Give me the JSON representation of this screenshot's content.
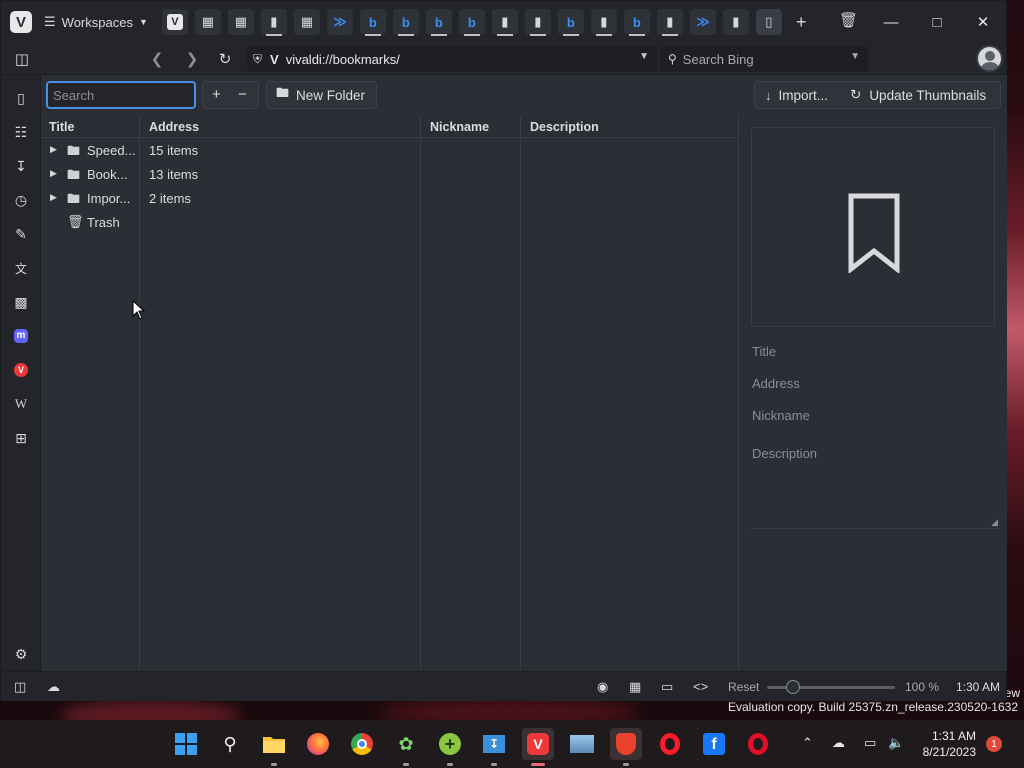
{
  "browser": {
    "workspaces_label": "Workspaces",
    "tab_icons": [
      "vivaldi",
      "grid",
      "grid",
      "doc",
      "grid",
      "bing",
      "bing",
      "bing",
      "bing",
      "bing",
      "doc",
      "doc",
      "bing",
      "doc",
      "bing",
      "doc",
      "bing",
      "doc",
      "bookmarks"
    ],
    "new_tab_label": "+",
    "url": "vivaldi://bookmarks/",
    "search_placeholder": "Search Bing"
  },
  "bookmarks": {
    "search_placeholder": "Search",
    "add_label": "+",
    "remove_label": "−",
    "new_folder_label": "New Folder",
    "import_label": "Import...",
    "update_thumbnails_label": "Update Thumbnails",
    "columns": {
      "title": "Title",
      "address": "Address",
      "nickname": "Nickname",
      "description": "Description"
    },
    "rows": [
      {
        "title": "Speed...",
        "address": "15 items",
        "expandable": true,
        "icon": "speed-dial-folder"
      },
      {
        "title": "Book...",
        "address": "13 items",
        "expandable": true,
        "icon": "folder"
      },
      {
        "title": "Impor...",
        "address": "2 items",
        "expandable": true,
        "icon": "folder"
      },
      {
        "title": "Trash",
        "address": "",
        "expandable": false,
        "icon": "trash"
      }
    ],
    "details": {
      "title_placeholder": "Title",
      "address_placeholder": "Address",
      "nickname_placeholder": "Nickname",
      "description_placeholder": "Description"
    }
  },
  "statusbar": {
    "reset_label": "Reset",
    "zoom": "100 %",
    "time": "1:30 AM"
  },
  "desktop": {
    "evaluation_text": "Evaluation copy. Build 25375.zn_release.230520-1632",
    "corner_text": "ew"
  },
  "taskbar": {
    "apps": [
      "windows-start",
      "search",
      "file-explorer",
      "firefox",
      "chrome",
      "app-plant",
      "app-green-plus",
      "app-installer",
      "vivaldi",
      "app-photos",
      "brave",
      "opera",
      "facebook",
      "opera-gx"
    ],
    "clock_time": "1:31 AM",
    "clock_date": "8/21/2023",
    "notification_count": "1"
  },
  "colors": {
    "accent": "#4a8fe8",
    "window_bg": "#2b2e35",
    "chrome_bg": "#23252b",
    "bing_blue": "#3b8ef0"
  }
}
